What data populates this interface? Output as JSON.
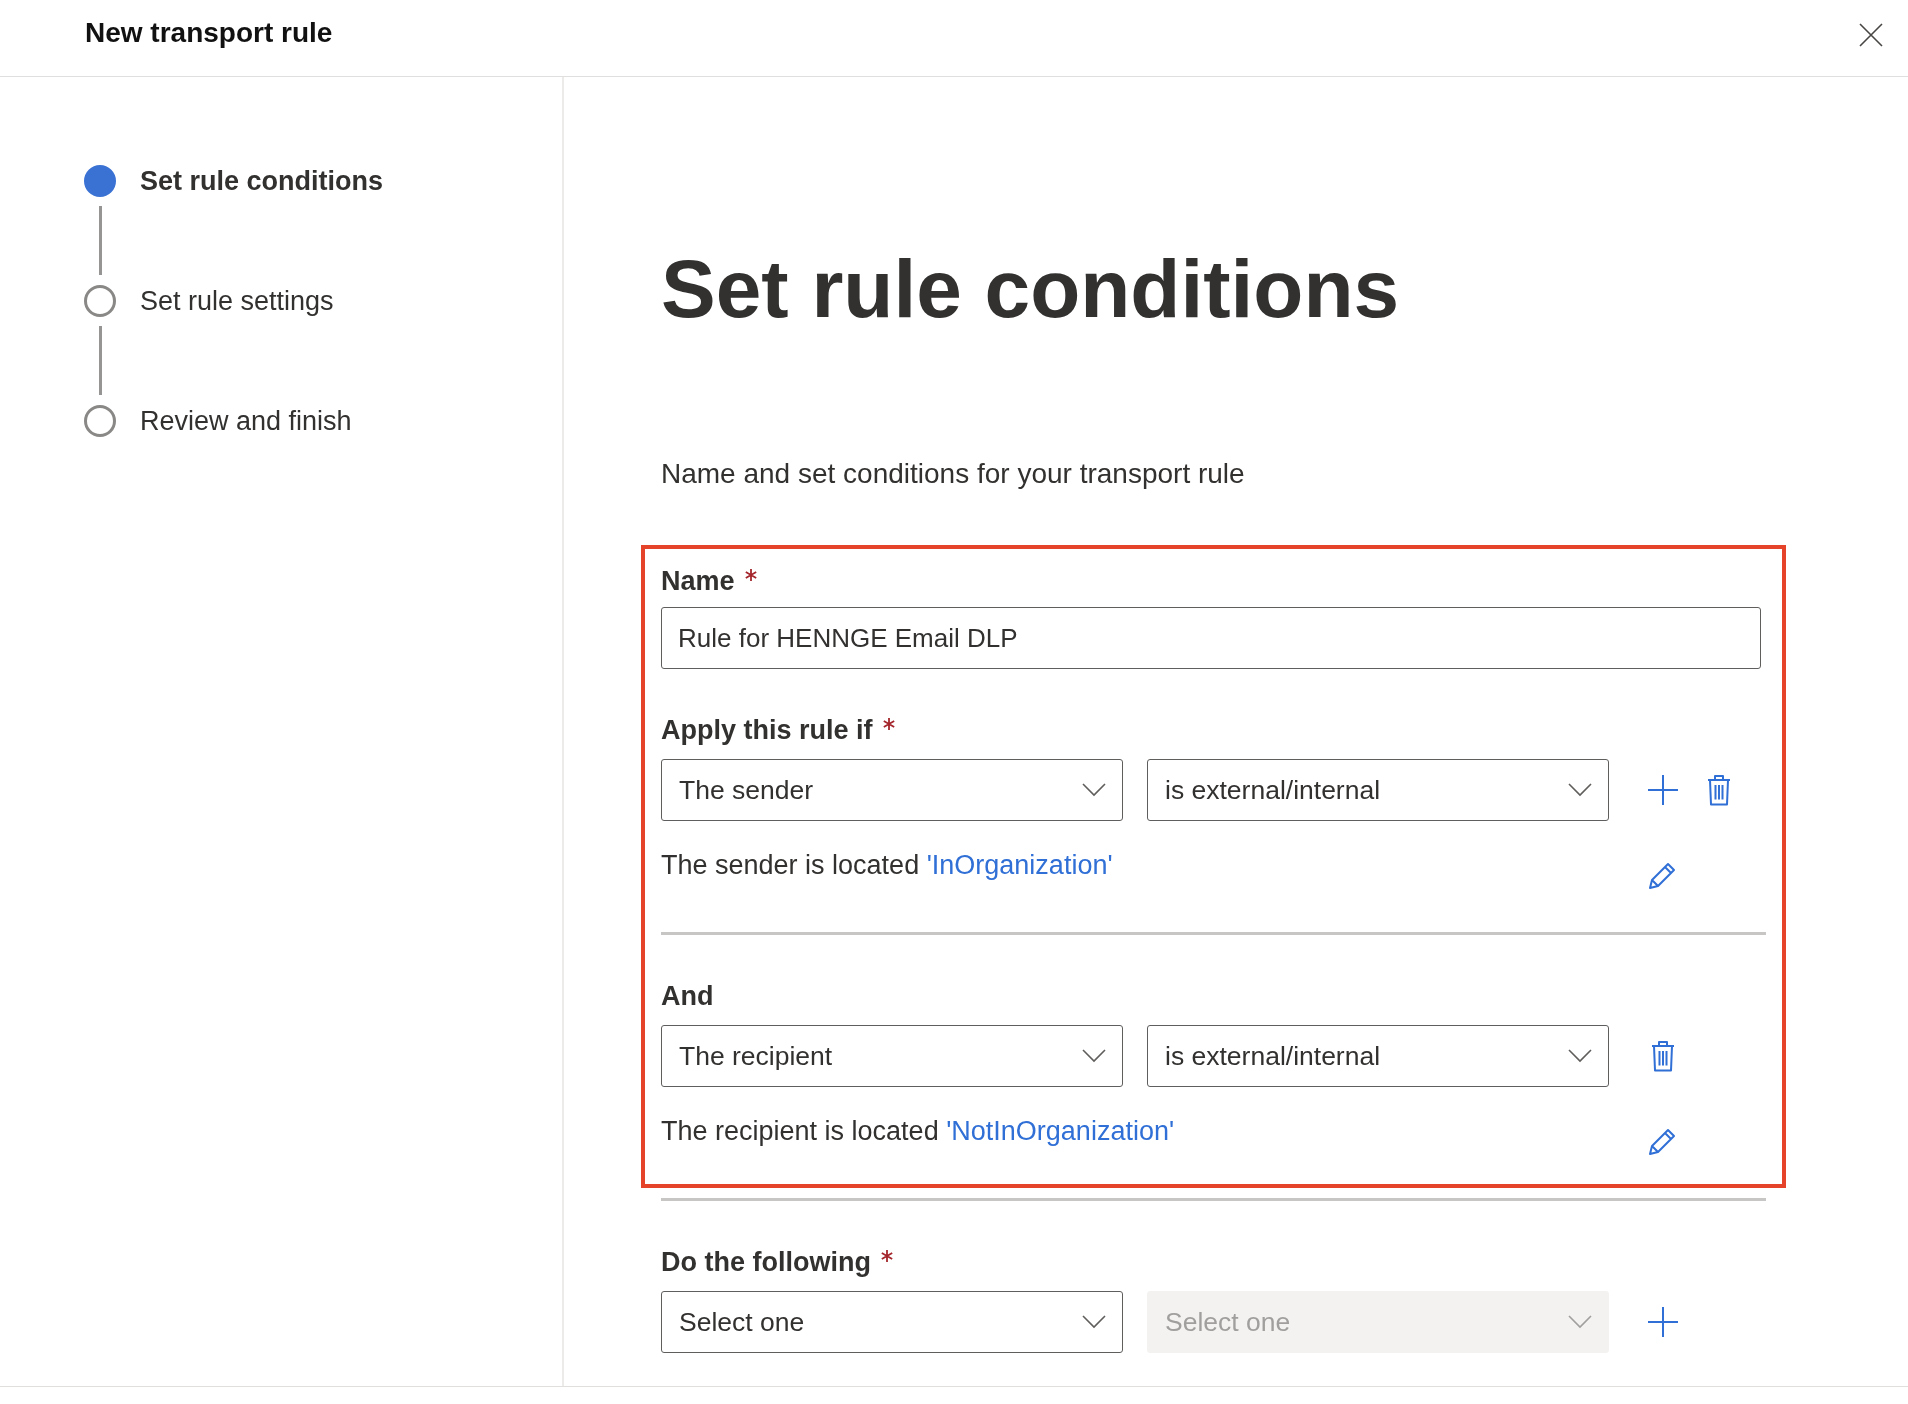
{
  "dialog": {
    "title": "New transport rule"
  },
  "steps": [
    {
      "label": "Set rule conditions",
      "selected": true
    },
    {
      "label": "Set rule settings",
      "selected": false
    },
    {
      "label": "Review and finish",
      "selected": false
    }
  ],
  "page": {
    "heading": "Set rule conditions",
    "description": "Name and set conditions for your transport rule"
  },
  "highlighted_section": {
    "highlighted": true,
    "name_field": {
      "label": "Name",
      "required": true,
      "value": "Rule for HENNGE Email DLP"
    },
    "conditions": [
      {
        "label": "Apply this rule if",
        "required": true,
        "dropdowns": [
          {
            "text": "The sender",
            "disabled": false
          },
          {
            "text": "is external/internal",
            "disabled": false
          }
        ],
        "buttons": [
          {
            "kind": "add"
          },
          {
            "kind": "delete"
          }
        ],
        "summary": {
          "text": "The sender is located",
          "link": "'InOrganization'"
        }
      },
      {
        "label": "And",
        "required": false,
        "dropdowns": [
          {
            "text": "The recipient",
            "disabled": false
          },
          {
            "text": "is external/internal",
            "disabled": false
          }
        ],
        "buttons": [
          {
            "kind": "delete"
          }
        ],
        "summary": {
          "text": "The recipient is located",
          "link": "'NotInOrganization'"
        }
      }
    ]
  },
  "actions": [
    {
      "label": "Do the following",
      "required": true,
      "dropdowns": [
        {
          "text": "Select one",
          "disabled": false
        },
        {
          "text": "Select one",
          "disabled": true
        }
      ],
      "buttons": [
        {
          "kind": "add"
        }
      ]
    }
  ]
}
